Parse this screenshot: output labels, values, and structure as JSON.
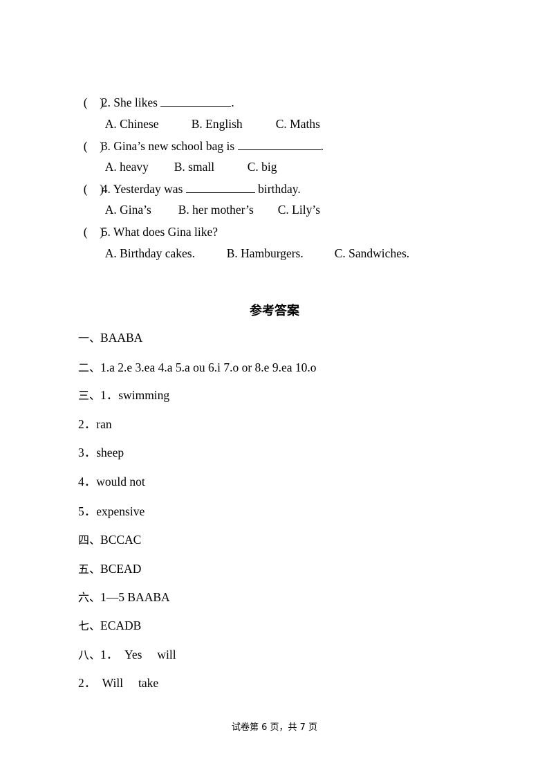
{
  "questions": [
    {
      "paren": "(    )",
      "stem_pre": "2. She likes ",
      "blank": true,
      "stem_post": ".",
      "options": [
        "A. Chinese",
        "B. English",
        "C. Maths"
      ]
    },
    {
      "paren": "(    )",
      "stem_pre": "3. Gina’s new school bag is ",
      "blank": true,
      "stem_post": ".",
      "options": [
        "A. heavy",
        "B. small",
        "C. big"
      ]
    },
    {
      "paren": "(    )",
      "stem_pre": "4. Yesterday was ",
      "blank": true,
      "stem_post": " birthday.",
      "options": [
        "A. Gina’s",
        "B. her mother’s",
        "C. Lily’s"
      ]
    },
    {
      "paren": "(    )",
      "stem_pre": "5. What does Gina like?",
      "blank": false,
      "stem_post": "",
      "options": [
        "A. Birthday cakes.",
        "B. Hamburgers.",
        "C. Sandwiches."
      ]
    }
  ],
  "answer_key": {
    "title": "参考答案",
    "lines": [
      {
        "label": "一、",
        "text": "BAABA"
      },
      {
        "label": "二、",
        "text": "1.a 2.e 3.ea 4.a 5.a ou 6.i 7.o or 8.e 9.ea 10.o"
      },
      {
        "label": "三、",
        "text": "1．swimming"
      },
      {
        "label": "",
        "text": "2．ran"
      },
      {
        "label": "",
        "text": "3．sheep"
      },
      {
        "label": "",
        "text": "4．would not"
      },
      {
        "label": "",
        "text": "5．expensive"
      },
      {
        "label": "四、",
        "text": "BCCAC"
      },
      {
        "label": "五、",
        "text": "BCEAD"
      },
      {
        "label": "六、",
        "text": "1—5 BAABA"
      },
      {
        "label": "七、",
        "text": "ECADB"
      },
      {
        "label": "八、",
        "text": "1．  Yes     will"
      },
      {
        "label": "",
        "text": "2．  Will     take"
      }
    ]
  },
  "footer": {
    "text": "试卷第 6 页，共 7 页"
  }
}
